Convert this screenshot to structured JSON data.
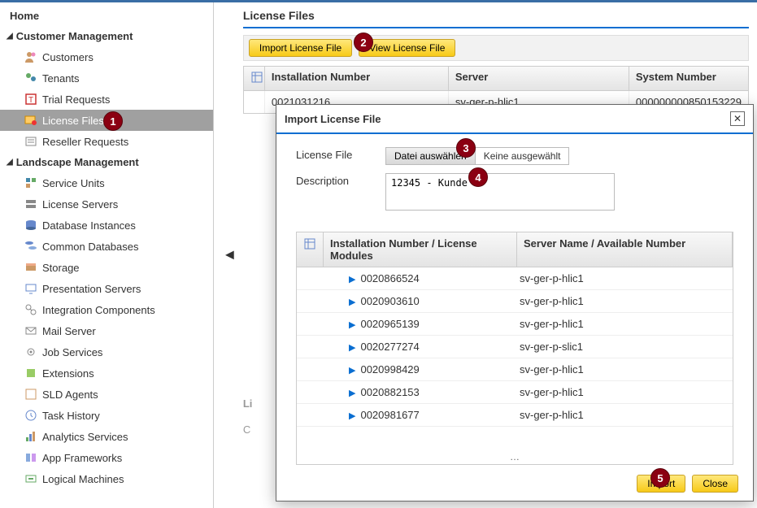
{
  "sidebar": {
    "home": "Home",
    "section1": "Customer Management",
    "items1": [
      {
        "label": "Customers"
      },
      {
        "label": "Tenants"
      },
      {
        "label": "Trial Requests"
      },
      {
        "label": "License Files"
      },
      {
        "label": "Reseller Requests"
      }
    ],
    "section2": "Landscape Management",
    "items2": [
      {
        "label": "Service Units"
      },
      {
        "label": "License Servers"
      },
      {
        "label": "Database Instances"
      },
      {
        "label": "Common Databases"
      },
      {
        "label": "Storage"
      },
      {
        "label": "Presentation Servers"
      },
      {
        "label": "Integration Components"
      },
      {
        "label": "Mail Server"
      },
      {
        "label": "Job Services"
      },
      {
        "label": "Extensions"
      },
      {
        "label": "SLD Agents"
      },
      {
        "label": "Task History"
      },
      {
        "label": "Analytics Services"
      },
      {
        "label": "App Frameworks"
      },
      {
        "label": "Logical Machines"
      }
    ]
  },
  "main": {
    "title": "License Files",
    "toolbar": {
      "import": "Import License File",
      "view": "View License File"
    },
    "grid": {
      "headers": {
        "inst": "Installation Number",
        "server": "Server",
        "sys": "System Number"
      },
      "row": {
        "inst": "0021031216",
        "server": "sv-ger-p-hlic1",
        "sys": "000000000850153229"
      }
    },
    "licLabel": "Li",
    "catLabel": "C"
  },
  "modal": {
    "title": "Import License File",
    "licFileLabel": "License File",
    "fileBtn": "Datei auswählen",
    "noFile": "Keine ausgewählt",
    "descLabel": "Description",
    "descValue": "12345 - Kunde",
    "gridHeaders": {
      "inst": "Installation Number / License Modules",
      "srv": "Server Name / Available Number"
    },
    "rows": [
      {
        "inst": "0020866524",
        "srv": "sv-ger-p-hlic1"
      },
      {
        "inst": "0020903610",
        "srv": "sv-ger-p-hlic1"
      },
      {
        "inst": "0020965139",
        "srv": "sv-ger-p-hlic1"
      },
      {
        "inst": "0020277274",
        "srv": "sv-ger-p-slic1"
      },
      {
        "inst": "0020998429",
        "srv": "sv-ger-p-hlic1"
      },
      {
        "inst": "0020882153",
        "srv": "sv-ger-p-hlic1"
      },
      {
        "inst": "0020981677",
        "srv": "sv-ger-p-hlic1"
      }
    ],
    "more": "…",
    "importBtn": "Import",
    "closeBtn": "Close"
  },
  "callouts": {
    "1": "1",
    "2": "2",
    "3": "3",
    "4": "4",
    "5": "5"
  }
}
